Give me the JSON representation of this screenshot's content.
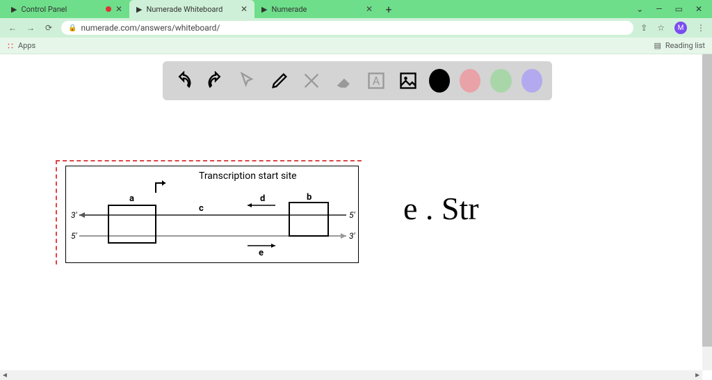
{
  "window": {
    "min": "—",
    "max": "▭",
    "close": "✕",
    "dropdown": "⌄"
  },
  "tabs": {
    "items": [
      {
        "title": "Control Panel",
        "recording": true
      },
      {
        "title": "Numerade Whiteboard",
        "active": true
      },
      {
        "title": "Numerade"
      }
    ],
    "close_glyph": "✕",
    "newtab_glyph": "+"
  },
  "omnibar": {
    "back": "←",
    "fwd": "→",
    "reload": "⟳",
    "lock": "🔒",
    "url": "numerade.com/answers/whiteboard/",
    "share": "⇪",
    "star": "☆",
    "avatar": "M",
    "menu": "⋮"
  },
  "bookmarks": {
    "apps": "Apps",
    "reading": "Reading list"
  },
  "toolbar": {
    "tools": [
      "undo",
      "redo",
      "pointer",
      "eraser-pencil",
      "tools-cross",
      "eraser",
      "textbox",
      "image"
    ],
    "colors": {
      "black": "#000000",
      "pink": "#e9a3a8",
      "green": "#a9d6a9",
      "purple": "#b3a9ef"
    }
  },
  "diagram": {
    "title": "Transcription start site",
    "labels": {
      "a": "a",
      "b": "b",
      "c": "c",
      "d": "d",
      "e": "e"
    },
    "ends": {
      "tl": "3′",
      "tr": "5′",
      "bl": "5′",
      "br": "3′"
    }
  },
  "handwriting": "e . Str",
  "chart_data": {
    "type": "diagram",
    "description": "Double-stranded DNA schematic with transcription start site arrow. Two boxes (a on left, b on right) on the top strand. Region between them labeled c. Arrow d points left above top strand between boxes. Arrow e points right below bottom strand. Top strand runs 3′→5′, bottom strand 5′→3′.",
    "top_strand": {
      "left_end": "3′",
      "right_end": "5′"
    },
    "bottom_strand": {
      "left_end": "5′",
      "right_end": "3′"
    },
    "elements": [
      "a (left box)",
      "b (right box)",
      "c (inter-box region)",
      "d (leftward arrow, top)",
      "e (rightward arrow, bottom)",
      "transcription start site (right-angle arrow above a)"
    ]
  }
}
